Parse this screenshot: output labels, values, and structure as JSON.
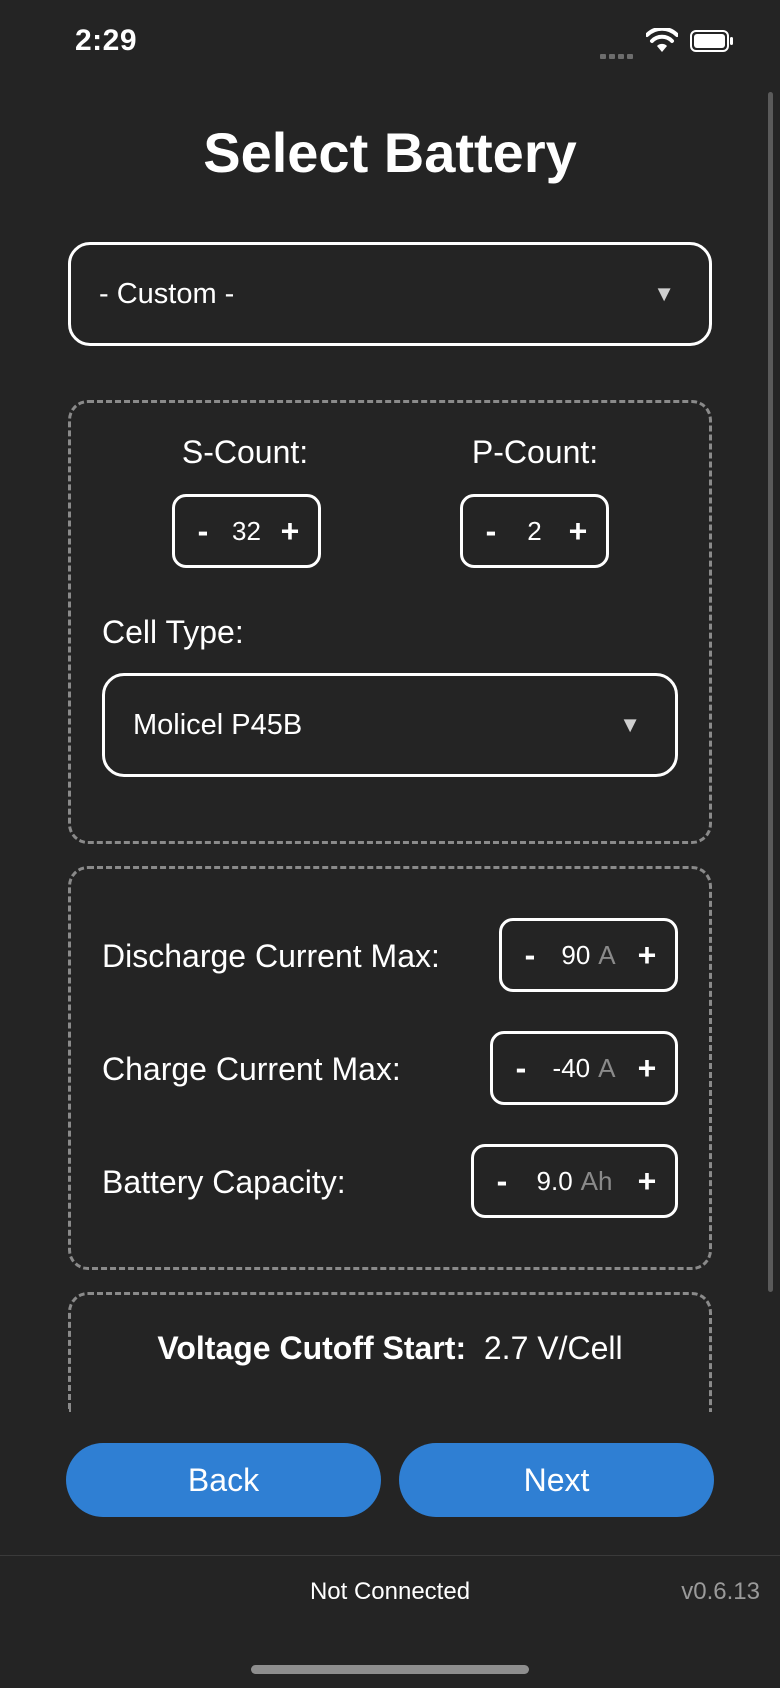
{
  "status_bar": {
    "time": "2:29"
  },
  "page": {
    "title": "Select Battery"
  },
  "battery_dropdown": {
    "value": "- Custom -"
  },
  "config": {
    "s_count": {
      "label": "S-Count:",
      "value": "32",
      "minus": "-",
      "plus": "+"
    },
    "p_count": {
      "label": "P-Count:",
      "value": "2",
      "minus": "-",
      "plus": "+"
    },
    "cell_type": {
      "label": "Cell Type:",
      "value": "Molicel P45B"
    }
  },
  "limits": {
    "discharge": {
      "label": "Discharge Current Max:",
      "value": "90",
      "unit": "A",
      "minus": "-",
      "plus": "+"
    },
    "charge": {
      "label": "Charge Current Max:",
      "value": "-40",
      "unit": "A",
      "minus": "-",
      "plus": "+"
    },
    "capacity": {
      "label": "Battery Capacity:",
      "value": "9.0",
      "unit": "Ah",
      "minus": "-",
      "plus": "+"
    }
  },
  "voltage_cutoff": {
    "label": "Voltage Cutoff Start:",
    "value": "2.7 V/Cell"
  },
  "buttons": {
    "back": "Back",
    "next": "Next"
  },
  "footer": {
    "status": "Not Connected",
    "version": "v0.6.13"
  },
  "colors": {
    "background": "#242424",
    "accent": "#2f7fd3",
    "panel_border": "#8a8a8a"
  }
}
